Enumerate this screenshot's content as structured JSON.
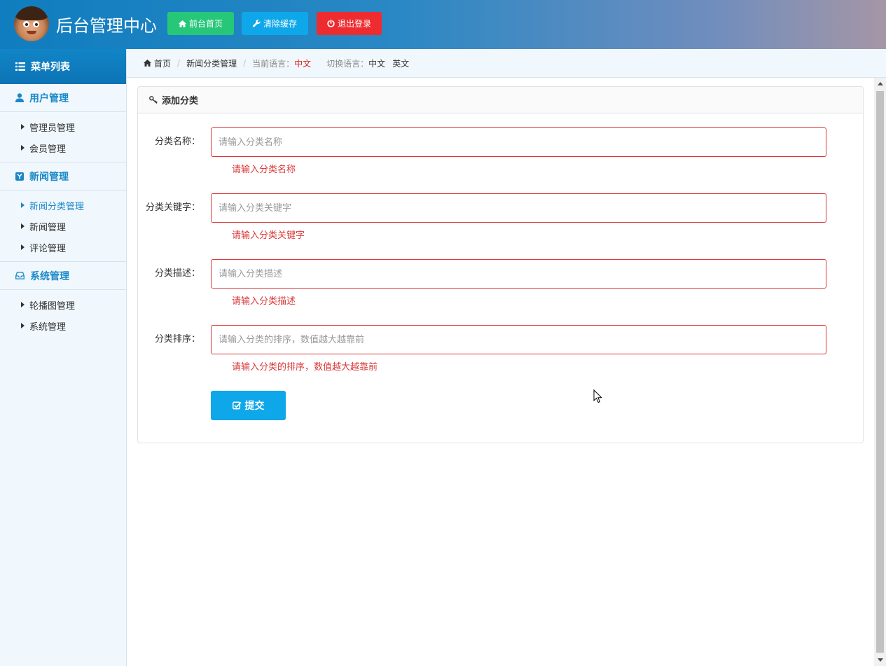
{
  "header": {
    "title": "后台管理中心",
    "buttons": {
      "home": "前台首页",
      "clear_cache": "清除缓存",
      "logout": "退出登录"
    }
  },
  "sidebar": {
    "menu_title": "菜单列表",
    "groups": [
      {
        "title": "用户管理",
        "icon": "user-icon",
        "items": [
          "管理员管理",
          "会员管理"
        ]
      },
      {
        "title": "新闻管理",
        "icon": "news-y-icon",
        "items": [
          "新闻分类管理",
          "新闻管理",
          "评论管理"
        ],
        "active_index": 0
      },
      {
        "title": "系统管理",
        "icon": "inbox-icon",
        "items": [
          "轮播图管理",
          "系统管理"
        ]
      }
    ]
  },
  "breadcrumb": {
    "home": "首页",
    "current_page": "新闻分类管理",
    "current_lang_label": "当前语言：",
    "current_lang_value": "中文",
    "switch_lang_label": "切换语言：",
    "lang_options": [
      "中文",
      "英文"
    ]
  },
  "panel": {
    "title": "添加分类",
    "fields": [
      {
        "label": "分类名称：",
        "placeholder": "请输入分类名称",
        "value": "",
        "error": "请输入分类名称"
      },
      {
        "label": "分类关键字：",
        "placeholder": "请输入分类关键字",
        "value": "",
        "error": "请输入分类关键字"
      },
      {
        "label": "分类描述：",
        "placeholder": "请输入分类描述",
        "value": "",
        "error": "请输入分类描述"
      },
      {
        "label": "分类排序：",
        "placeholder": "请输入分类的排序，数值越大越靠前",
        "value": "",
        "error": "请输入分类的排序，数值越大越靠前"
      }
    ],
    "submit_label": "提交"
  },
  "colors": {
    "header_gradient_start": "#0f7dbf",
    "accent_blue": "#0ea7ea",
    "green": "#27c77a",
    "red": "#ee2b2f",
    "error_red": "#d9393a",
    "sidebar_bg": "#f1f8fd"
  }
}
